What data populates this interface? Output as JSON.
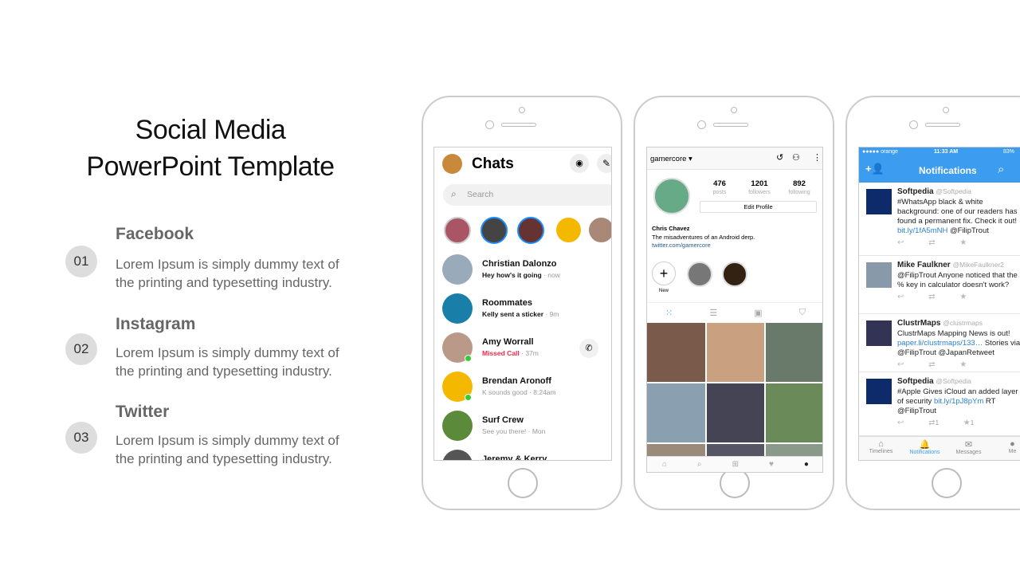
{
  "title": {
    "line1": "Social Media",
    "line2": "PowerPoint Template"
  },
  "items": [
    {
      "num": "01",
      "heading": "Facebook",
      "body": "Lorem Ipsum is simply dummy text of the printing and typesetting industry."
    },
    {
      "num": "02",
      "heading": "Instagram",
      "body": "Lorem Ipsum is simply dummy text of the printing and typesetting industry."
    },
    {
      "num": "03",
      "heading": "Twitter",
      "body": "Lorem Ipsum is simply dummy text of the printing and typesetting industry."
    }
  ],
  "messenger": {
    "title": "Chats",
    "search_placeholder": "Search",
    "chats": [
      {
        "name": "Christian Dalonzo",
        "msg": "Hey how's it going",
        "time": " · now",
        "color": "#9ab"
      },
      {
        "name": "Roommates",
        "msg": "Kelly sent a sticker",
        "time": " · 9m",
        "color": "#1a7fa8"
      },
      {
        "name": "Amy Worrall",
        "msg": "Missed Call",
        "time": " · 37m",
        "color": "#b98"
      },
      {
        "name": "Brendan Aronoff",
        "msg": "K sounds good · 8:24am",
        "time": "",
        "color": "#f5b800"
      },
      {
        "name": "Surf Crew",
        "msg": "See you there! · Mon",
        "time": "",
        "color": "#5a8a3a"
      },
      {
        "name": "Jeremy & Kerry",
        "msg": "",
        "time": "",
        "color": "#555"
      }
    ]
  },
  "instagram": {
    "username": "gamercore",
    "posts": "476",
    "posts_label": "posts",
    "followers": "1201",
    "followers_label": "followers",
    "following": "892",
    "following_label": "following",
    "edit": "Edit Profile",
    "name": "Chris Chavez",
    "bio": "The misadventures of an Android derp.",
    "link": "twitter.com/gamercore",
    "new_label": "New"
  },
  "twitter": {
    "carrier": "●●●●● orange",
    "time": "11:33 AM",
    "battery": "83%",
    "title": "Notifications",
    "tweets": [
      {
        "name": "Softpedia",
        "handle": "@Softpedia",
        "lines": [
          "#WhatsApp black & white",
          "background: one of our readers has",
          "found a permanent fix. Check it out!"
        ],
        "link": "bit.ly/1fA5mNH",
        "after": " @FilipTrout"
      },
      {
        "name": "Mike Faulkner",
        "handle": "@MikeFaulkner2",
        "lines": [
          "@FilipTrout Anyone noticed that the",
          "% key in calculator doesn't work?"
        ]
      },
      {
        "name": "ClustrMaps",
        "handle": "@clustrmaps",
        "lines": [
          "ClustrMaps Mapping News is out!"
        ],
        "link": "paper.li/clustrmaps/133…",
        "after": " Stories via",
        "line_end": "@FilipTrout @JapanRetweet"
      },
      {
        "name": "Softpedia",
        "handle": "@Softpedia",
        "lines": [
          "#Apple Gives iCloud an added layer"
        ],
        "pre": "of security ",
        "link": "bit.ly/1pJ8pYm",
        "after": " RT",
        "line_end": "@FilipTrout",
        "retweets": "1",
        "favorites": "1"
      }
    ],
    "tabs": [
      "Timelines",
      "Notifications",
      "Messages",
      "Me"
    ]
  },
  "colors": {
    "twitter_blue": "#3b9cf0",
    "messenger_blue": "#1a8cff",
    "missed_call": "#f0284a",
    "softpedia": "#0d2a6b"
  }
}
